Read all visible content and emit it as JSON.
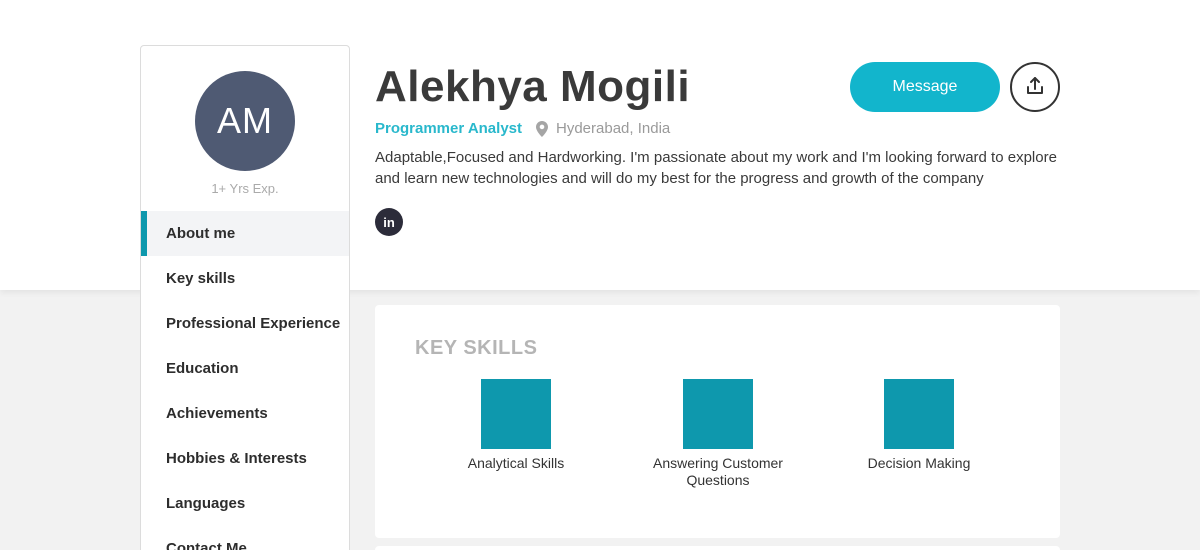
{
  "profile": {
    "initials": "AM",
    "experience": "1+ Yrs Exp.",
    "name": "Alekhya Mogili",
    "title": "Programmer Analyst",
    "location": "Hyderabad, India",
    "bio": "Adaptable,Focused and Hardworking. I'm passionate about my work and I'm looking forward to explore and learn new technologies and will do my best for the progress and growth of the company",
    "linkedin_label": "in"
  },
  "actions": {
    "message_label": "Message",
    "share_icon": "share-icon"
  },
  "sidebar": {
    "items": [
      {
        "label": "About me",
        "active": true
      },
      {
        "label": "Key skills",
        "active": false
      },
      {
        "label": "Professional Experience",
        "active": false
      },
      {
        "label": "Education",
        "active": false
      },
      {
        "label": "Achievements",
        "active": false
      },
      {
        "label": "Hobbies & Interests",
        "active": false
      },
      {
        "label": "Languages",
        "active": false
      },
      {
        "label": "Contact Me",
        "active": false
      }
    ]
  },
  "key_skills": {
    "heading": "KEY SKILLS",
    "items": [
      {
        "label": "Analytical Skills"
      },
      {
        "label": "Answering Customer Questions"
      },
      {
        "label": "Decision Making"
      }
    ]
  },
  "colors": {
    "accent": "#12b5cc",
    "skill_tile": "#0e98ad",
    "avatar_bg": "#4f5a73"
  }
}
